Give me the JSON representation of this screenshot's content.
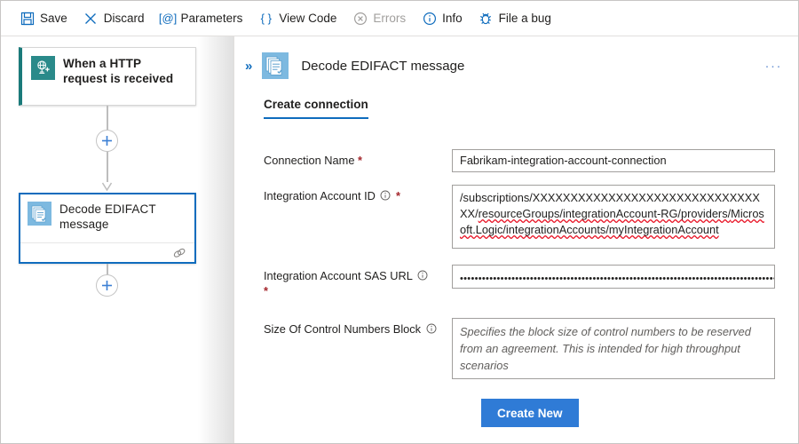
{
  "toolbar": {
    "items": [
      {
        "label": "Save",
        "icon": "save-icon",
        "disabled": false
      },
      {
        "label": "Discard",
        "icon": "close-x-icon",
        "disabled": false
      },
      {
        "label": "Parameters",
        "icon": "at-bracket-icon",
        "disabled": false
      },
      {
        "label": "View Code",
        "icon": "curly-braces-icon",
        "disabled": false
      },
      {
        "label": "Errors",
        "icon": "error-circle-icon",
        "disabled": true
      },
      {
        "label": "Info",
        "icon": "info-circle-icon",
        "disabled": false
      },
      {
        "label": "File a bug",
        "icon": "bug-icon",
        "disabled": false
      }
    ]
  },
  "canvas": {
    "trigger_node": {
      "title": "When a HTTP request is received",
      "icon": "http-request-globe-icon",
      "accent_color": "#1a7a7a"
    },
    "add_button_1_label": "+",
    "action_node": {
      "title": "Decode EDIFACT message",
      "icon": "edifact-documents-icon",
      "footer_icon": "connection-link-icon",
      "selected_border_color": "#0f6cbd"
    },
    "add_button_2_label": "+"
  },
  "panel": {
    "collapse_label": "»",
    "title": "Decode EDIFACT message",
    "icon": "edifact-documents-icon",
    "more_label": "···",
    "tab": {
      "label": "Create connection"
    },
    "fields": [
      {
        "label": "Connection Name",
        "required": true,
        "has_info": false,
        "value": "Fabrikam-integration-account-connection",
        "placeholder": ""
      },
      {
        "label": "Integration Account ID",
        "required": true,
        "has_info": true,
        "value": "/subscriptions/XXXXXXXXXXXXXXXXXXXXXXXXXXXXXXXX/resourceGroups/integrationAccount-RG/providers/Microsoft.Logic/integrationAccounts/myIntegrationAccount",
        "value_parts": [
          {
            "text": "/subscriptions/XXXXXXXXXXXXXXXXXXXXXXXXXXXXXXXX/",
            "spellcheck_error": false
          },
          {
            "text": "resourceGroups/integrationAccount-RG/providers/",
            "spellcheck_error": true
          },
          {
            "text": "Microsoft.Logic/integrationAccounts/myIntegrationAccount",
            "spellcheck_error": true
          }
        ],
        "placeholder": ""
      },
      {
        "label": "Integration Account SAS URL",
        "required": true,
        "has_info": true,
        "masked": true,
        "value": "••••••••••••••••••••••••••••••••••••••••••••••••••••••••••••••••••••••••••••••••••••••••••••••••••••••••••••••••…",
        "placeholder": ""
      },
      {
        "label": "Size Of Control Numbers Block",
        "required": false,
        "has_info": true,
        "value": "",
        "placeholder": "Specifies the block size of control numbers to be reserved from an agreement. This is intended for high throughput scenarios"
      }
    ],
    "create_button": {
      "label": "Create New",
      "color": "#2f7bd6"
    }
  }
}
